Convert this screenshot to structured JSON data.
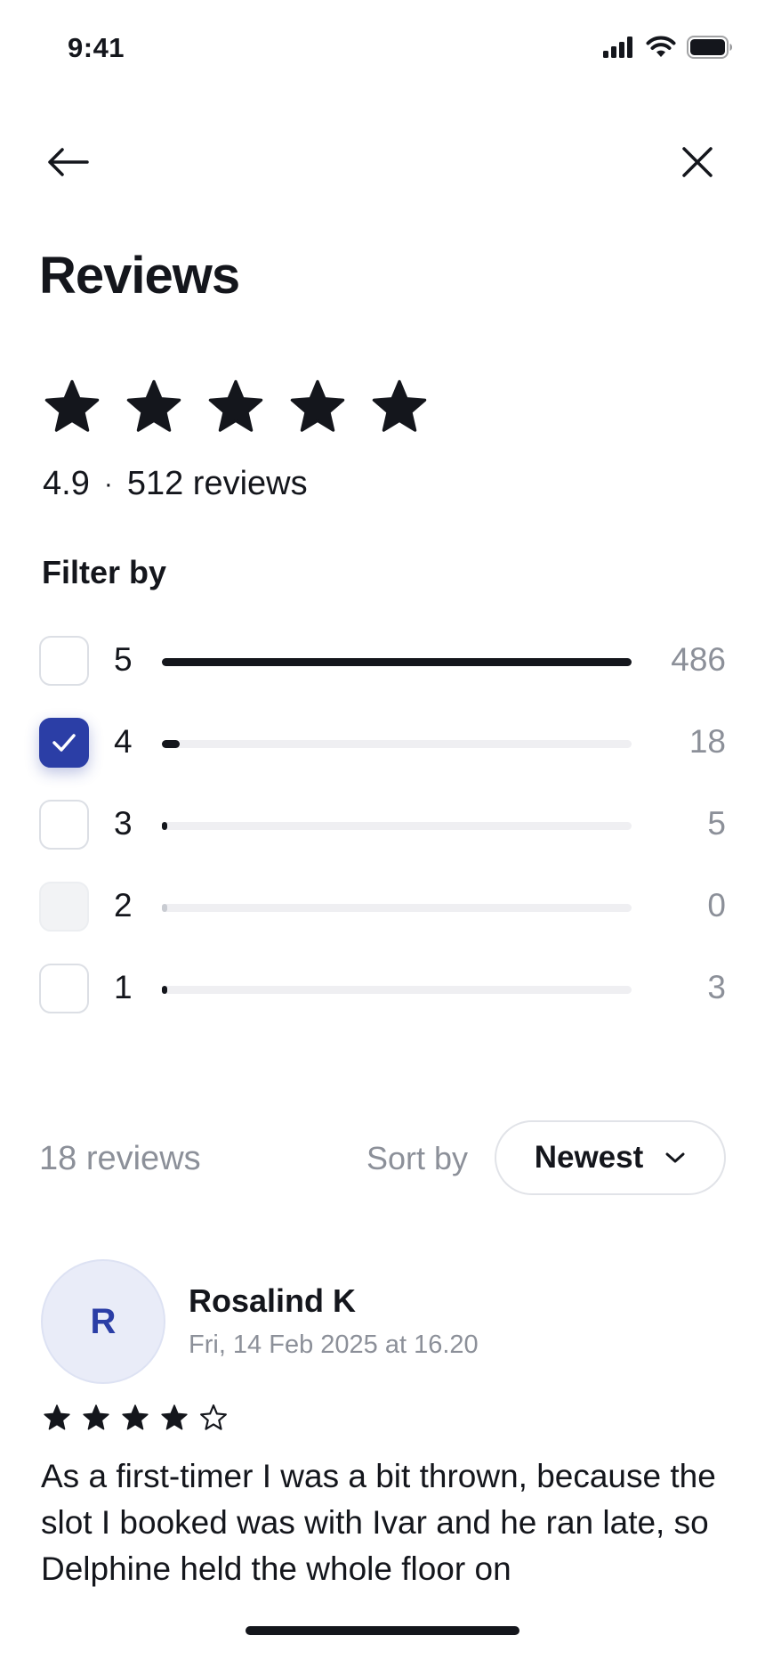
{
  "status_bar": {
    "time": "9:41",
    "icons": [
      "cellular-signal-icon",
      "wifi-icon",
      "battery-icon"
    ]
  },
  "nav": {
    "back_icon": "arrow-left-icon",
    "close_icon": "close-icon"
  },
  "page": {
    "title": "Reviews"
  },
  "summary": {
    "stars_filled": 5,
    "stars_total": 5,
    "average": "4.9",
    "separator": "·",
    "total_reviews": "512 reviews"
  },
  "filter": {
    "label": "Filter by",
    "rows": [
      {
        "stars": "5",
        "count": "486",
        "fraction": 1.0,
        "checked": false,
        "disabled": false
      },
      {
        "stars": "4",
        "count": "18",
        "fraction": 0.037,
        "checked": true,
        "disabled": false
      },
      {
        "stars": "3",
        "count": "5",
        "fraction": 0.01,
        "checked": false,
        "disabled": false
      },
      {
        "stars": "2",
        "count": "0",
        "fraction": 0.0,
        "checked": false,
        "disabled": true
      },
      {
        "stars": "1",
        "count": "3",
        "fraction": 0.006,
        "checked": false,
        "disabled": false
      }
    ]
  },
  "list": {
    "results_count": "18 reviews",
    "sort_label": "Sort by",
    "sort_value": "Newest",
    "sort_icon": "chevron-down-icon"
  },
  "reviews": [
    {
      "avatar_initial": "R",
      "name": "Rosalind K",
      "date": "Fri, 14 Feb 2025 at 16.20",
      "rating": 4,
      "rating_max": 5,
      "text": "As a first-timer I was a bit thrown, because the slot I booked was with Ivar and he ran late, so Delphine held the whole floor on"
    }
  ],
  "colors": {
    "accent": "#2b3ea6",
    "text_primary": "#14161c",
    "text_secondary": "#8c9099",
    "bar_track": "#efeff2",
    "avatar_bg": "#e9ecf8"
  }
}
